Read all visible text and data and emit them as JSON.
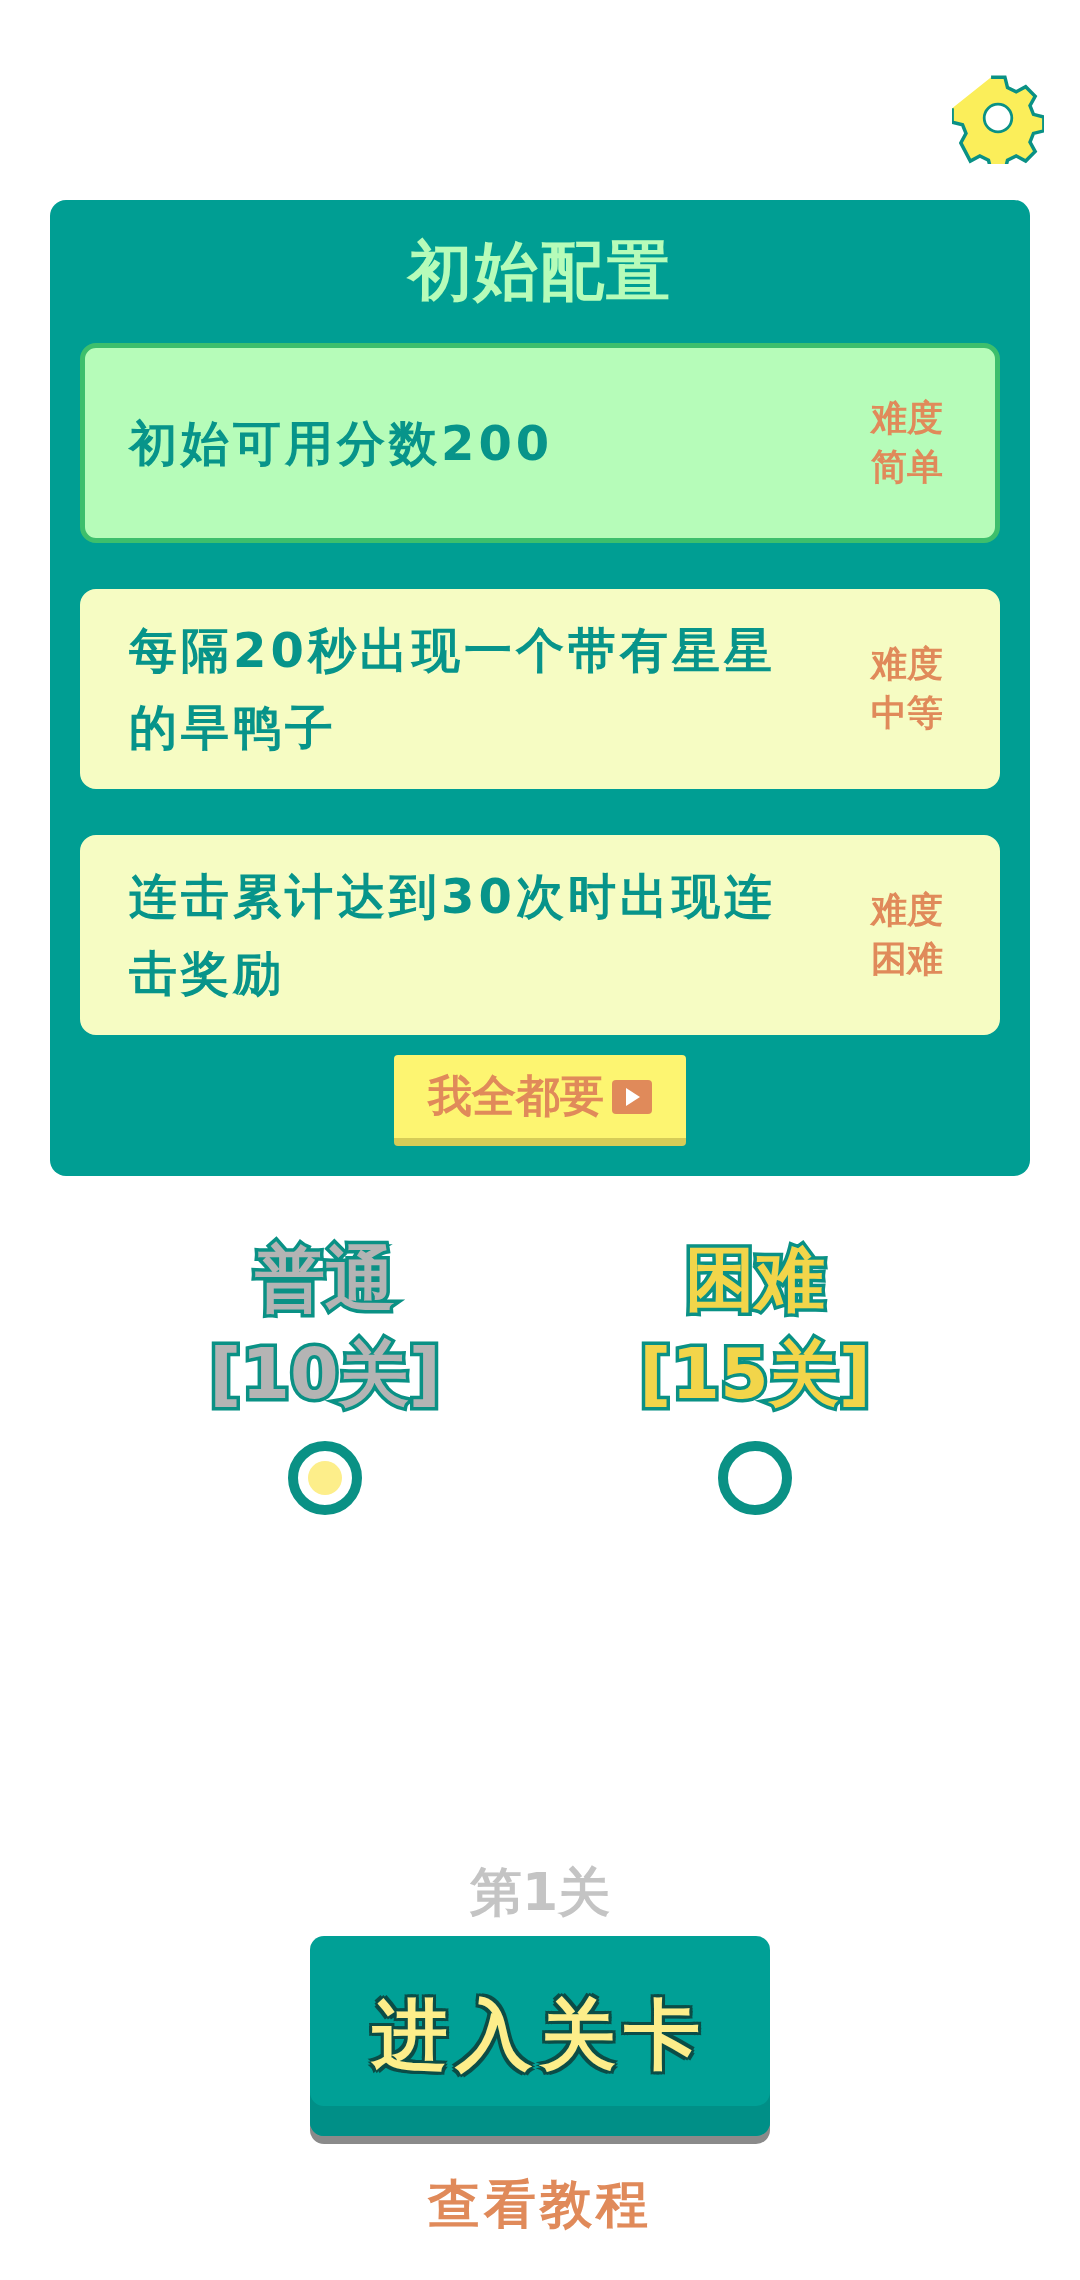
{
  "panel": {
    "title": "初始配置",
    "options": [
      {
        "text": "初始可用分数200",
        "difficulty_label": "难度",
        "difficulty": "简单",
        "selected": true
      },
      {
        "text": "每隔20秒出现一个带有星星的旱鸭子",
        "difficulty_label": "难度",
        "difficulty": "中等",
        "selected": false
      },
      {
        "text": "连击累计达到30次时出现连击奖励",
        "difficulty_label": "难度",
        "difficulty": "困难",
        "selected": false
      }
    ],
    "take_all_button": "我全都要"
  },
  "modes": [
    {
      "name": "普通",
      "levels": "[10关]",
      "selected": true
    },
    {
      "name": "困难",
      "levels": "[15关]",
      "selected": false
    }
  ],
  "current_level": "第1关",
  "start_button": "进入关卡",
  "tutorial_link": "查看教程"
}
